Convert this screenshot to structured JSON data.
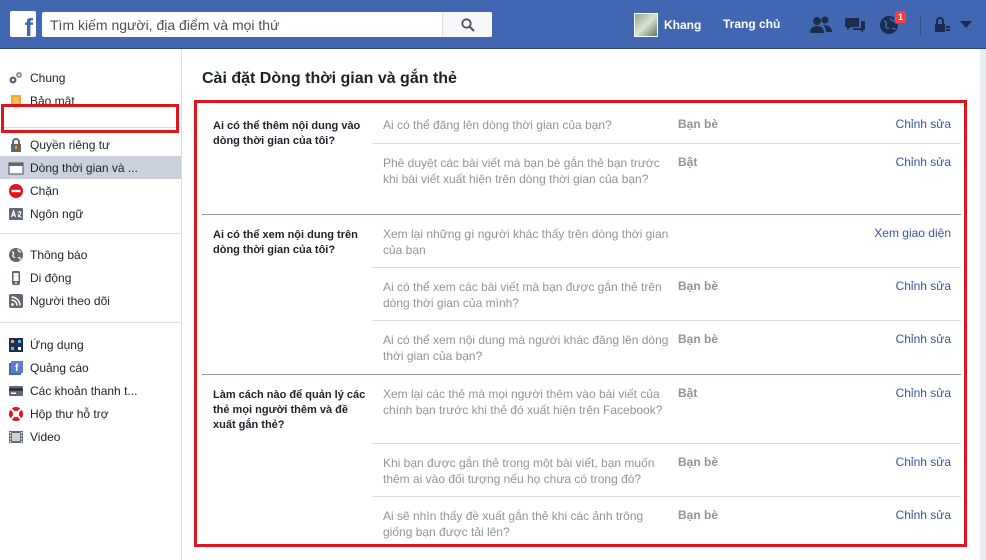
{
  "header": {
    "logo": "f",
    "search_placeholder": "Tìm kiếm người, địa điểm và mọi thứ",
    "profile_name": "Khang",
    "home_label": "Trang chủ",
    "notification_count": "1"
  },
  "sidebar": {
    "groups": [
      [
        {
          "label": "Chung",
          "icon": "gears-icon"
        },
        {
          "label": "Bảo mật",
          "icon": "badge-icon"
        }
      ],
      [
        {
          "label": "Quyền riêng tư",
          "icon": "lock-icon"
        },
        {
          "label": "Dòng thời gian và ...",
          "icon": "timeline-icon",
          "active": true
        },
        {
          "label": "Chặn",
          "icon": "block-icon"
        },
        {
          "label": "Ngôn ngữ",
          "icon": "language-icon"
        }
      ],
      [
        {
          "label": "Thông báo",
          "icon": "globe-icon"
        },
        {
          "label": "Di động",
          "icon": "mobile-icon"
        },
        {
          "label": "Người theo dõi",
          "icon": "rss-icon"
        }
      ],
      [
        {
          "label": "Ứng dụng",
          "icon": "apps-icon"
        },
        {
          "label": "Quảng cáo",
          "icon": "ads-icon"
        },
        {
          "label": "Các khoản thanh t...",
          "icon": "card-icon"
        },
        {
          "label": "Hộp thư hỗ trợ",
          "icon": "lifebuoy-icon"
        },
        {
          "label": "Video",
          "icon": "film-icon"
        }
      ]
    ]
  },
  "main": {
    "title": "Cài đặt Dòng thời gian và gắn thẻ",
    "sections": [
      {
        "heading": "Ai có thể thêm nội dung vào dòng thời gian của tôi?",
        "rows": [
          {
            "question": "Ai có thể đăng lên dòng thời gian của bạn?",
            "value": "Bạn bè",
            "action": "Chỉnh sửa"
          },
          {
            "question": "Phê duyệt các bài viết mà bạn bè gắn thẻ bạn trước khi bài viết xuất hiện trên dòng thời gian của bạn?",
            "value": "Bật",
            "action": "Chỉnh sửa"
          }
        ]
      },
      {
        "heading": "Ai có thể xem nội dung trên dòng thời gian của tôi?",
        "rows": [
          {
            "question": "Xem lại những gì người khác thấy trên dòng thời gian của bạn",
            "value": "",
            "action": "Xem giao diện"
          },
          {
            "question": "Ai có thể xem các bài viết mà bạn được gắn thẻ trên dòng thời gian của mình?",
            "value": "Bạn bè",
            "action": "Chỉnh sửa"
          },
          {
            "question": "Ai có thể xem nội dung mà người khác đăng lên dòng thời gian của bạn?",
            "value": "Bạn bè",
            "action": "Chỉnh sửa"
          }
        ]
      },
      {
        "heading": "Làm cách nào để quản lý các thẻ mọi người thêm và đề xuất gắn thẻ?",
        "rows": [
          {
            "question": "Xem lại các thẻ mà mọi người thêm vào bài viết của chính bạn trước khi thẻ đó xuất hiện trên Facebook?",
            "value": "Bật",
            "action": "Chỉnh sửa"
          },
          {
            "question": "Khi bạn được gắn thẻ trong một bài viết, bạn muốn thêm ai vào đối tượng nếu họ chưa có trong đó?",
            "value": "Bạn bè",
            "action": "Chỉnh sửa"
          },
          {
            "question": "Ai sẽ nhìn thấy đề xuất gắn thẻ khi các ảnh trông giống bạn được tải lên?",
            "value": "Bạn bè",
            "action": "Chỉnh sửa"
          }
        ]
      }
    ]
  },
  "colors": {
    "brand": "#4267b2",
    "link": "#365899",
    "highlight": "#e0141e"
  }
}
